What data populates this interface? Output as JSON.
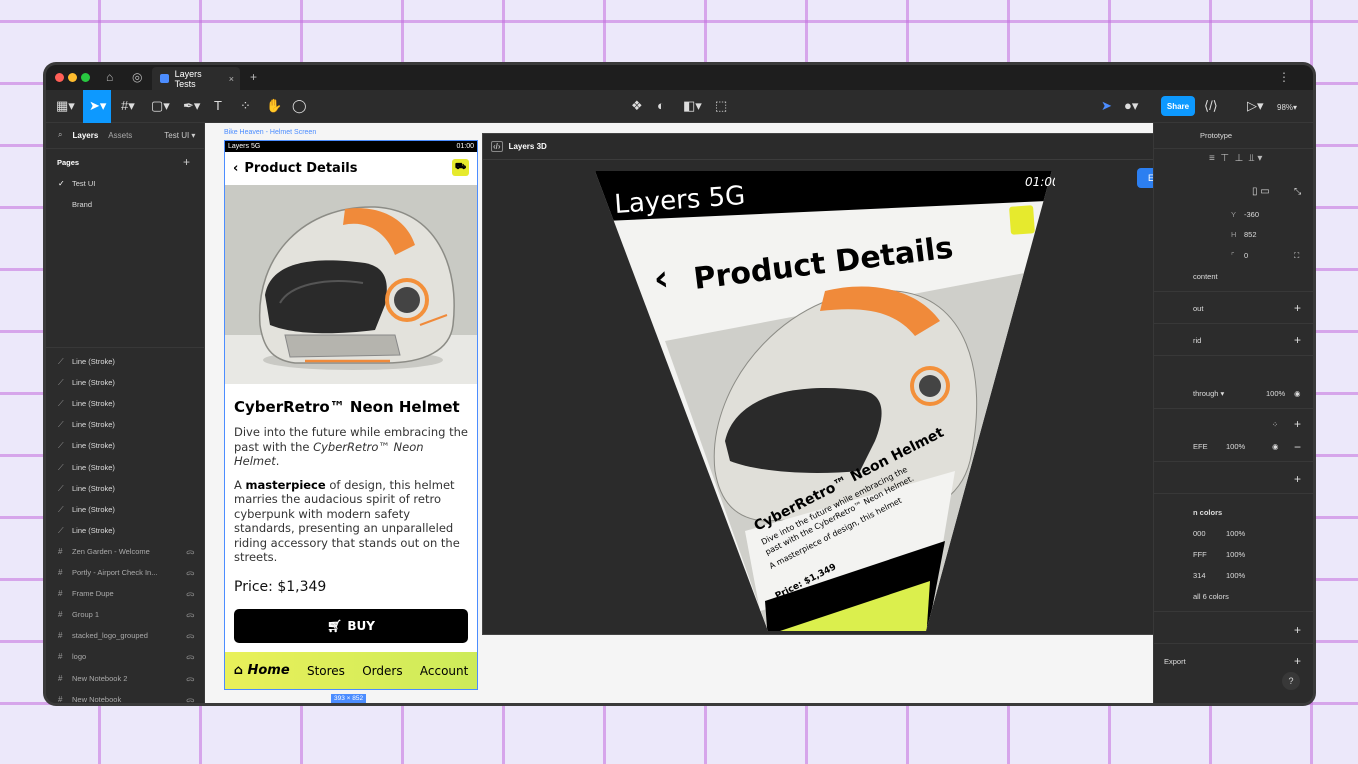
{
  "titlebar": {
    "tab_title": "Layers Tests",
    "close": "×",
    "new_tab": "+",
    "menu": "⋮"
  },
  "toolbar": {
    "share": "Share",
    "zoom": "98%"
  },
  "left_panel": {
    "tabs": {
      "layers": "Layers",
      "assets": "Assets",
      "page_menu": "Test UI"
    },
    "pages_header": "Pages",
    "pages": [
      {
        "label": "Test UI",
        "checked": true
      },
      {
        "label": "Brand",
        "checked": false
      }
    ],
    "layers": [
      {
        "label": "Line (Stroke)",
        "icon": "line-icon"
      },
      {
        "label": "Line (Stroke)",
        "icon": "line-icon"
      },
      {
        "label": "Line (Stroke)",
        "icon": "line-icon"
      },
      {
        "label": "Line (Stroke)",
        "icon": "line-icon"
      },
      {
        "label": "Line (Stroke)",
        "icon": "line-icon"
      },
      {
        "label": "Line (Stroke)",
        "icon": "line-icon"
      },
      {
        "label": "Line (Stroke)",
        "icon": "line-icon"
      },
      {
        "label": "Line (Stroke)",
        "icon": "line-icon"
      },
      {
        "label": "Line (Stroke)",
        "icon": "line-icon"
      },
      {
        "label": "Zen Garden - Welcome",
        "icon": "frame-icon"
      },
      {
        "label": "Portly - Airport Check In...",
        "icon": "frame-icon"
      },
      {
        "label": "Frame Dupe",
        "icon": "frame-icon"
      },
      {
        "label": "Group 1",
        "icon": "frame-icon"
      },
      {
        "label": "stacked_logo_grouped",
        "icon": "frame-icon"
      },
      {
        "label": "logo",
        "icon": "frame-icon"
      },
      {
        "label": "New Notebook 2",
        "icon": "frame-icon"
      },
      {
        "label": "New Notebook",
        "icon": "frame-icon"
      }
    ]
  },
  "canvas": {
    "frame_label": "Bike Heaven - Helmet Screen",
    "size_badge": "393 × 852",
    "phone": {
      "status_left": "Layers 5G",
      "status_right": "01:00",
      "header_title": "Product Details",
      "product_title": "CyberRetro™ Neon Helmet",
      "p1_a": "Dive into the future while embracing the past with the ",
      "p1_em": "CyberRetro™ Neon Helmet",
      "p1_end": ".",
      "p2_a": "A ",
      "p2_strong": "masterpiece",
      "p2_b": " of design, this helmet marries the audacious spirit of retro cyberpunk with modern safety standards, presenting an unparalleled riding accessory that stands out on the streets.",
      "price": "Price: $1,349",
      "buy": "BUY",
      "nav": {
        "home": "Home",
        "stores": "Stores",
        "orders": "Orders",
        "account": "Account"
      }
    }
  },
  "modal": {
    "title": "Layers 3D",
    "export": "Export",
    "close": "×",
    "p3d": {
      "status_left": "Layers 5G",
      "status_right": "01:00",
      "header_title": "Product Details",
      "product_title": "CyberRetro™ Neon Helmet",
      "line1": "Dive into the future while embracing the",
      "line2": "past with the CyberRetro™ Neon Helmet.",
      "line3": "A masterpiece of design, this helmet",
      "line4": "Price: $1,349"
    }
  },
  "right_panel": {
    "tab_prototype": "Prototype",
    "y_label": "Y",
    "y_value": "-360",
    "h_label": "H",
    "h_value": "852",
    "r_value": "0",
    "clip": "content",
    "layout": "out",
    "grid": "rid",
    "blend": "through",
    "blend_pct": "100%",
    "fill_hex": "EFE",
    "fill_pct": "100%",
    "sel_colors": "n colors",
    "colors": [
      {
        "hex": "000",
        "pct": "100%"
      },
      {
        "hex": "FFF",
        "pct": "100%"
      },
      {
        "hex": "314",
        "pct": "100%"
      }
    ],
    "all_colors": "all 6 colors",
    "export": "Export",
    "help": "?"
  },
  "colors": {
    "accent": "#0d99ff",
    "nav_bar": "#e6ea2d",
    "grid_line": "#c46ede"
  }
}
